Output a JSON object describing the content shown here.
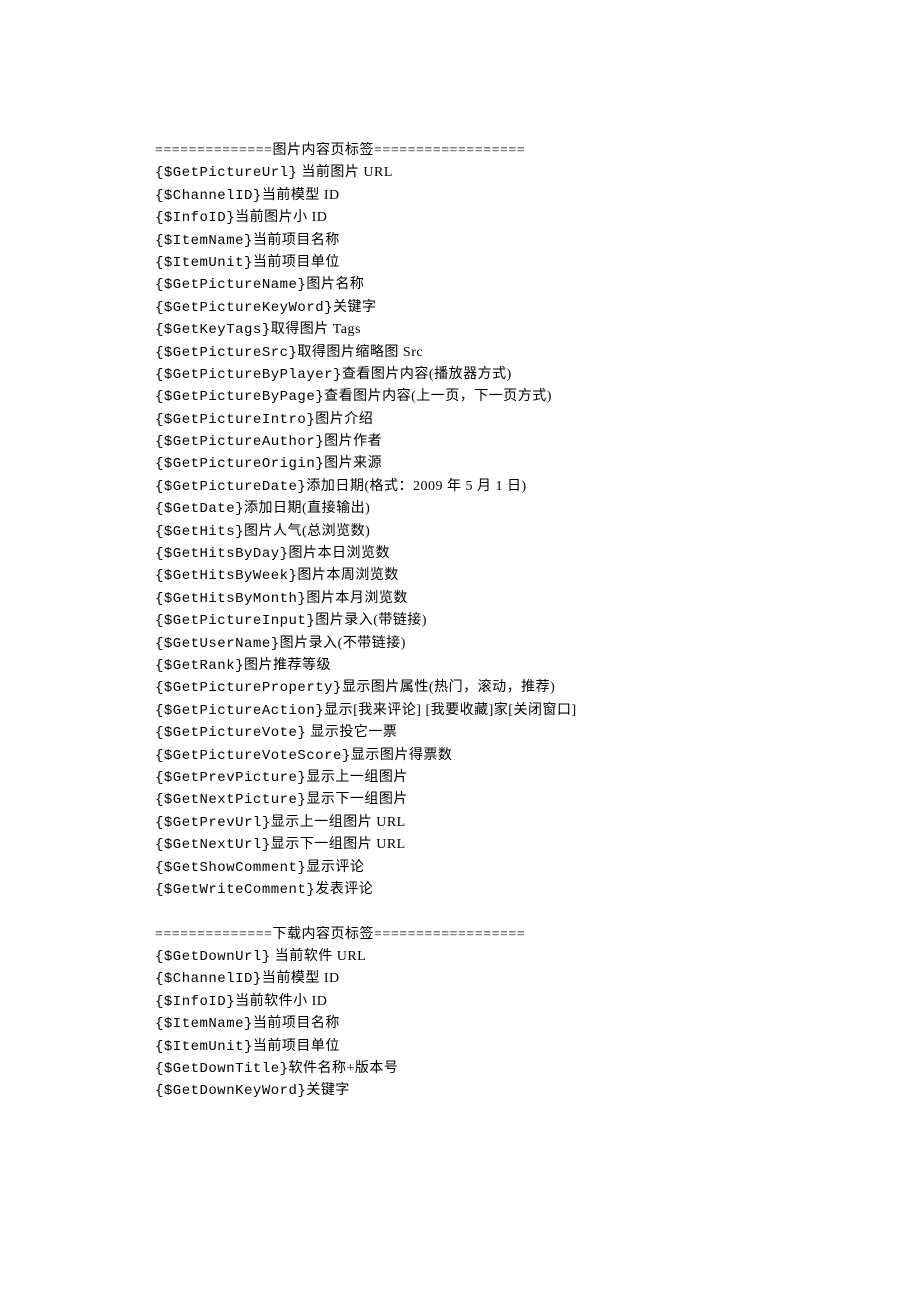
{
  "sections": [
    {
      "header": "==============图片内容页标签==================",
      "items": [
        {
          "tag": "{$GetPictureUrl}",
          "sp": " ",
          "desc": "当前图片 URL"
        },
        {
          "tag": "{$ChannelID}",
          "sp": "",
          "desc": "当前模型 ID"
        },
        {
          "tag": "{$InfoID}",
          "sp": "",
          "desc": "当前图片小 ID"
        },
        {
          "tag": "{$ItemName}",
          "sp": "",
          "desc": "当前项目名称"
        },
        {
          "tag": "{$ItemUnit}",
          "sp": "",
          "desc": "当前项目单位"
        },
        {
          "tag": "{$GetPictureName}",
          "sp": "",
          "desc": "图片名称"
        },
        {
          "tag": "{$GetPictureKeyWord}",
          "sp": "",
          "desc": "关键字"
        },
        {
          "tag": "{$GetKeyTags}",
          "sp": "",
          "desc": "取得图片 Tags"
        },
        {
          "tag": "{$GetPictureSrc}",
          "sp": "",
          "desc": "取得图片缩略图 Src"
        },
        {
          "tag": "{$GetPictureByPlayer}",
          "sp": "",
          "desc": "查看图片内容(播放器方式)"
        },
        {
          "tag": "{$GetPictureByPage}",
          "sp": "",
          "desc": "查看图片内容(上一页，下一页方式)"
        },
        {
          "tag": "{$GetPictureIntro}",
          "sp": "",
          "desc": "图片介绍"
        },
        {
          "tag": "{$GetPictureAuthor}",
          "sp": "",
          "desc": "图片作者"
        },
        {
          "tag": "{$GetPictureOrigin}",
          "sp": "",
          "desc": "图片来源"
        },
        {
          "tag": "{$GetPictureDate}",
          "sp": "",
          "desc": "添加日期(格式：2009 年 5 月 1 日)"
        },
        {
          "tag": "{$GetDate}",
          "sp": "",
          "desc": "添加日期(直接输出)"
        },
        {
          "tag": "{$GetHits}",
          "sp": "",
          "desc": "图片人气(总浏览数)"
        },
        {
          "tag": "{$GetHitsByDay}",
          "sp": "",
          "desc": "图片本日浏览数"
        },
        {
          "tag": "{$GetHitsByWeek}",
          "sp": "",
          "desc": "图片本周浏览数"
        },
        {
          "tag": "{$GetHitsByMonth}",
          "sp": "",
          "desc": "图片本月浏览数"
        },
        {
          "tag": "{$GetPictureInput}",
          "sp": "",
          "desc": "图片录入(带链接)"
        },
        {
          "tag": "{$GetUserName}",
          "sp": "",
          "desc": "图片录入(不带链接)"
        },
        {
          "tag": "{$GetRank}",
          "sp": "",
          "desc": "图片推荐等级"
        },
        {
          "tag": "{$GetPictureProperty}",
          "sp": "",
          "desc": "显示图片属性(热门，滚动，推荐)"
        },
        {
          "tag": "{$GetPictureAction}",
          "sp": "",
          "desc": "显示[我来评论] [我要收藏]家[关闭窗口]"
        },
        {
          "tag": "{$GetPictureVote}",
          "sp": " ",
          "desc": "显示投它一票"
        },
        {
          "tag": "{$GetPictureVoteScore}",
          "sp": "",
          "desc": "显示图片得票数"
        },
        {
          "tag": "{$GetPrevPicture}",
          "sp": "",
          "desc": "显示上一组图片"
        },
        {
          "tag": "{$GetNextPicture}",
          "sp": "",
          "desc": "显示下一组图片"
        },
        {
          "tag": "{$GetPrevUrl}",
          "sp": "",
          "desc": "显示上一组图片 URL"
        },
        {
          "tag": "{$GetNextUrl}",
          "sp": "",
          "desc": "显示下一组图片 URL"
        },
        {
          "tag": "{$GetShowComment}",
          "sp": "",
          "desc": "显示评论"
        },
        {
          "tag": "{$GetWriteComment}",
          "sp": "",
          "desc": "发表评论"
        }
      ]
    },
    {
      "header": "==============下载内容页标签==================",
      "items": [
        {
          "tag": "{$GetDownUrl}",
          "sp": " ",
          "desc": "当前软件 URL"
        },
        {
          "tag": "{$ChannelID}",
          "sp": "",
          "desc": "当前模型 ID"
        },
        {
          "tag": "{$InfoID}",
          "sp": "",
          "desc": "当前软件小 ID"
        },
        {
          "tag": "{$ItemName}",
          "sp": "",
          "desc": "当前项目名称"
        },
        {
          "tag": "{$ItemUnit}",
          "sp": "",
          "desc": "当前项目单位"
        },
        {
          "tag": "{$GetDownTitle}",
          "sp": "",
          "desc": "软件名称+版本号"
        },
        {
          "tag": "{$GetDownKeyWord}",
          "sp": "",
          "desc": "关键字"
        }
      ]
    }
  ]
}
